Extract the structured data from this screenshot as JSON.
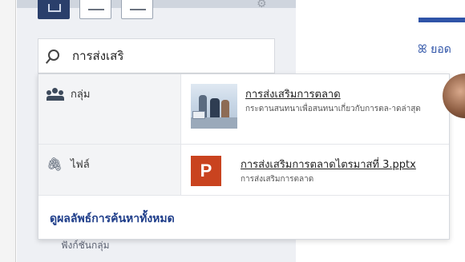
{
  "search": {
    "query": "การส่งเสริ"
  },
  "categories": [
    {
      "label": "กลุ่ม",
      "icon": "people-icon"
    },
    {
      "label": "ไฟล์",
      "icon": "paperclip-icon"
    }
  ],
  "results": [
    {
      "title": "การส่งเสริมการตลาด",
      "subtitle": "กระดานสนทนาเพื่อสนทนาเกี่ยวกับการตล-าดล่าสุด",
      "thumbnail": "group-photo"
    },
    {
      "title": "การส่งเสริมการตลาดไตรมาสที่ 3.pptx",
      "subtitle": "การส่งเสริมการตลาด",
      "thumbnail": "powerpoint-icon",
      "badge": "P"
    }
  ],
  "see_all_label": "ดูผลลัพธ์การค้นหาทั้งหมด",
  "right_panel": {
    "label": "ยอด",
    "glyph": "ꕤ"
  },
  "background_text": {
    "line1": "ฟังก์ชันกลุ่ม",
    "line2": ""
  },
  "colors": {
    "accent": "#2f54a8",
    "link": "#1f3e8a",
    "ppt": "#c9431f",
    "view_active": "#2a3f6b"
  }
}
